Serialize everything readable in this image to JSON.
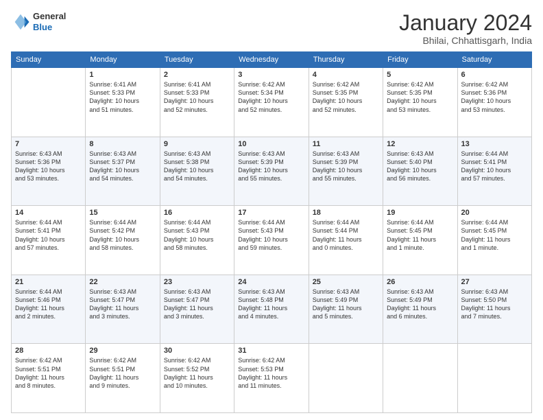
{
  "logo": {
    "general": "General",
    "blue": "Blue"
  },
  "title": "January 2024",
  "subtitle": "Bhilai, Chhattisgarh, India",
  "headers": [
    "Sunday",
    "Monday",
    "Tuesday",
    "Wednesday",
    "Thursday",
    "Friday",
    "Saturday"
  ],
  "weeks": [
    [
      {
        "day": "",
        "info": ""
      },
      {
        "day": "1",
        "info": "Sunrise: 6:41 AM\nSunset: 5:33 PM\nDaylight: 10 hours\nand 51 minutes."
      },
      {
        "day": "2",
        "info": "Sunrise: 6:41 AM\nSunset: 5:33 PM\nDaylight: 10 hours\nand 52 minutes."
      },
      {
        "day": "3",
        "info": "Sunrise: 6:42 AM\nSunset: 5:34 PM\nDaylight: 10 hours\nand 52 minutes."
      },
      {
        "day": "4",
        "info": "Sunrise: 6:42 AM\nSunset: 5:35 PM\nDaylight: 10 hours\nand 52 minutes."
      },
      {
        "day": "5",
        "info": "Sunrise: 6:42 AM\nSunset: 5:35 PM\nDaylight: 10 hours\nand 53 minutes."
      },
      {
        "day": "6",
        "info": "Sunrise: 6:42 AM\nSunset: 5:36 PM\nDaylight: 10 hours\nand 53 minutes."
      }
    ],
    [
      {
        "day": "7",
        "info": "Sunrise: 6:43 AM\nSunset: 5:36 PM\nDaylight: 10 hours\nand 53 minutes."
      },
      {
        "day": "8",
        "info": "Sunrise: 6:43 AM\nSunset: 5:37 PM\nDaylight: 10 hours\nand 54 minutes."
      },
      {
        "day": "9",
        "info": "Sunrise: 6:43 AM\nSunset: 5:38 PM\nDaylight: 10 hours\nand 54 minutes."
      },
      {
        "day": "10",
        "info": "Sunrise: 6:43 AM\nSunset: 5:39 PM\nDaylight: 10 hours\nand 55 minutes."
      },
      {
        "day": "11",
        "info": "Sunrise: 6:43 AM\nSunset: 5:39 PM\nDaylight: 10 hours\nand 55 minutes."
      },
      {
        "day": "12",
        "info": "Sunrise: 6:43 AM\nSunset: 5:40 PM\nDaylight: 10 hours\nand 56 minutes."
      },
      {
        "day": "13",
        "info": "Sunrise: 6:44 AM\nSunset: 5:41 PM\nDaylight: 10 hours\nand 57 minutes."
      }
    ],
    [
      {
        "day": "14",
        "info": "Sunrise: 6:44 AM\nSunset: 5:41 PM\nDaylight: 10 hours\nand 57 minutes."
      },
      {
        "day": "15",
        "info": "Sunrise: 6:44 AM\nSunset: 5:42 PM\nDaylight: 10 hours\nand 58 minutes."
      },
      {
        "day": "16",
        "info": "Sunrise: 6:44 AM\nSunset: 5:43 PM\nDaylight: 10 hours\nand 58 minutes."
      },
      {
        "day": "17",
        "info": "Sunrise: 6:44 AM\nSunset: 5:43 PM\nDaylight: 10 hours\nand 59 minutes."
      },
      {
        "day": "18",
        "info": "Sunrise: 6:44 AM\nSunset: 5:44 PM\nDaylight: 11 hours\nand 0 minutes."
      },
      {
        "day": "19",
        "info": "Sunrise: 6:44 AM\nSunset: 5:45 PM\nDaylight: 11 hours\nand 1 minute."
      },
      {
        "day": "20",
        "info": "Sunrise: 6:44 AM\nSunset: 5:45 PM\nDaylight: 11 hours\nand 1 minute."
      }
    ],
    [
      {
        "day": "21",
        "info": "Sunrise: 6:44 AM\nSunset: 5:46 PM\nDaylight: 11 hours\nand 2 minutes."
      },
      {
        "day": "22",
        "info": "Sunrise: 6:43 AM\nSunset: 5:47 PM\nDaylight: 11 hours\nand 3 minutes."
      },
      {
        "day": "23",
        "info": "Sunrise: 6:43 AM\nSunset: 5:47 PM\nDaylight: 11 hours\nand 3 minutes."
      },
      {
        "day": "24",
        "info": "Sunrise: 6:43 AM\nSunset: 5:48 PM\nDaylight: 11 hours\nand 4 minutes."
      },
      {
        "day": "25",
        "info": "Sunrise: 6:43 AM\nSunset: 5:49 PM\nDaylight: 11 hours\nand 5 minutes."
      },
      {
        "day": "26",
        "info": "Sunrise: 6:43 AM\nSunset: 5:49 PM\nDaylight: 11 hours\nand 6 minutes."
      },
      {
        "day": "27",
        "info": "Sunrise: 6:43 AM\nSunset: 5:50 PM\nDaylight: 11 hours\nand 7 minutes."
      }
    ],
    [
      {
        "day": "28",
        "info": "Sunrise: 6:42 AM\nSunset: 5:51 PM\nDaylight: 11 hours\nand 8 minutes."
      },
      {
        "day": "29",
        "info": "Sunrise: 6:42 AM\nSunset: 5:51 PM\nDaylight: 11 hours\nand 9 minutes."
      },
      {
        "day": "30",
        "info": "Sunrise: 6:42 AM\nSunset: 5:52 PM\nDaylight: 11 hours\nand 10 minutes."
      },
      {
        "day": "31",
        "info": "Sunrise: 6:42 AM\nSunset: 5:53 PM\nDaylight: 11 hours\nand 11 minutes."
      },
      {
        "day": "",
        "info": ""
      },
      {
        "day": "",
        "info": ""
      },
      {
        "day": "",
        "info": ""
      }
    ]
  ]
}
